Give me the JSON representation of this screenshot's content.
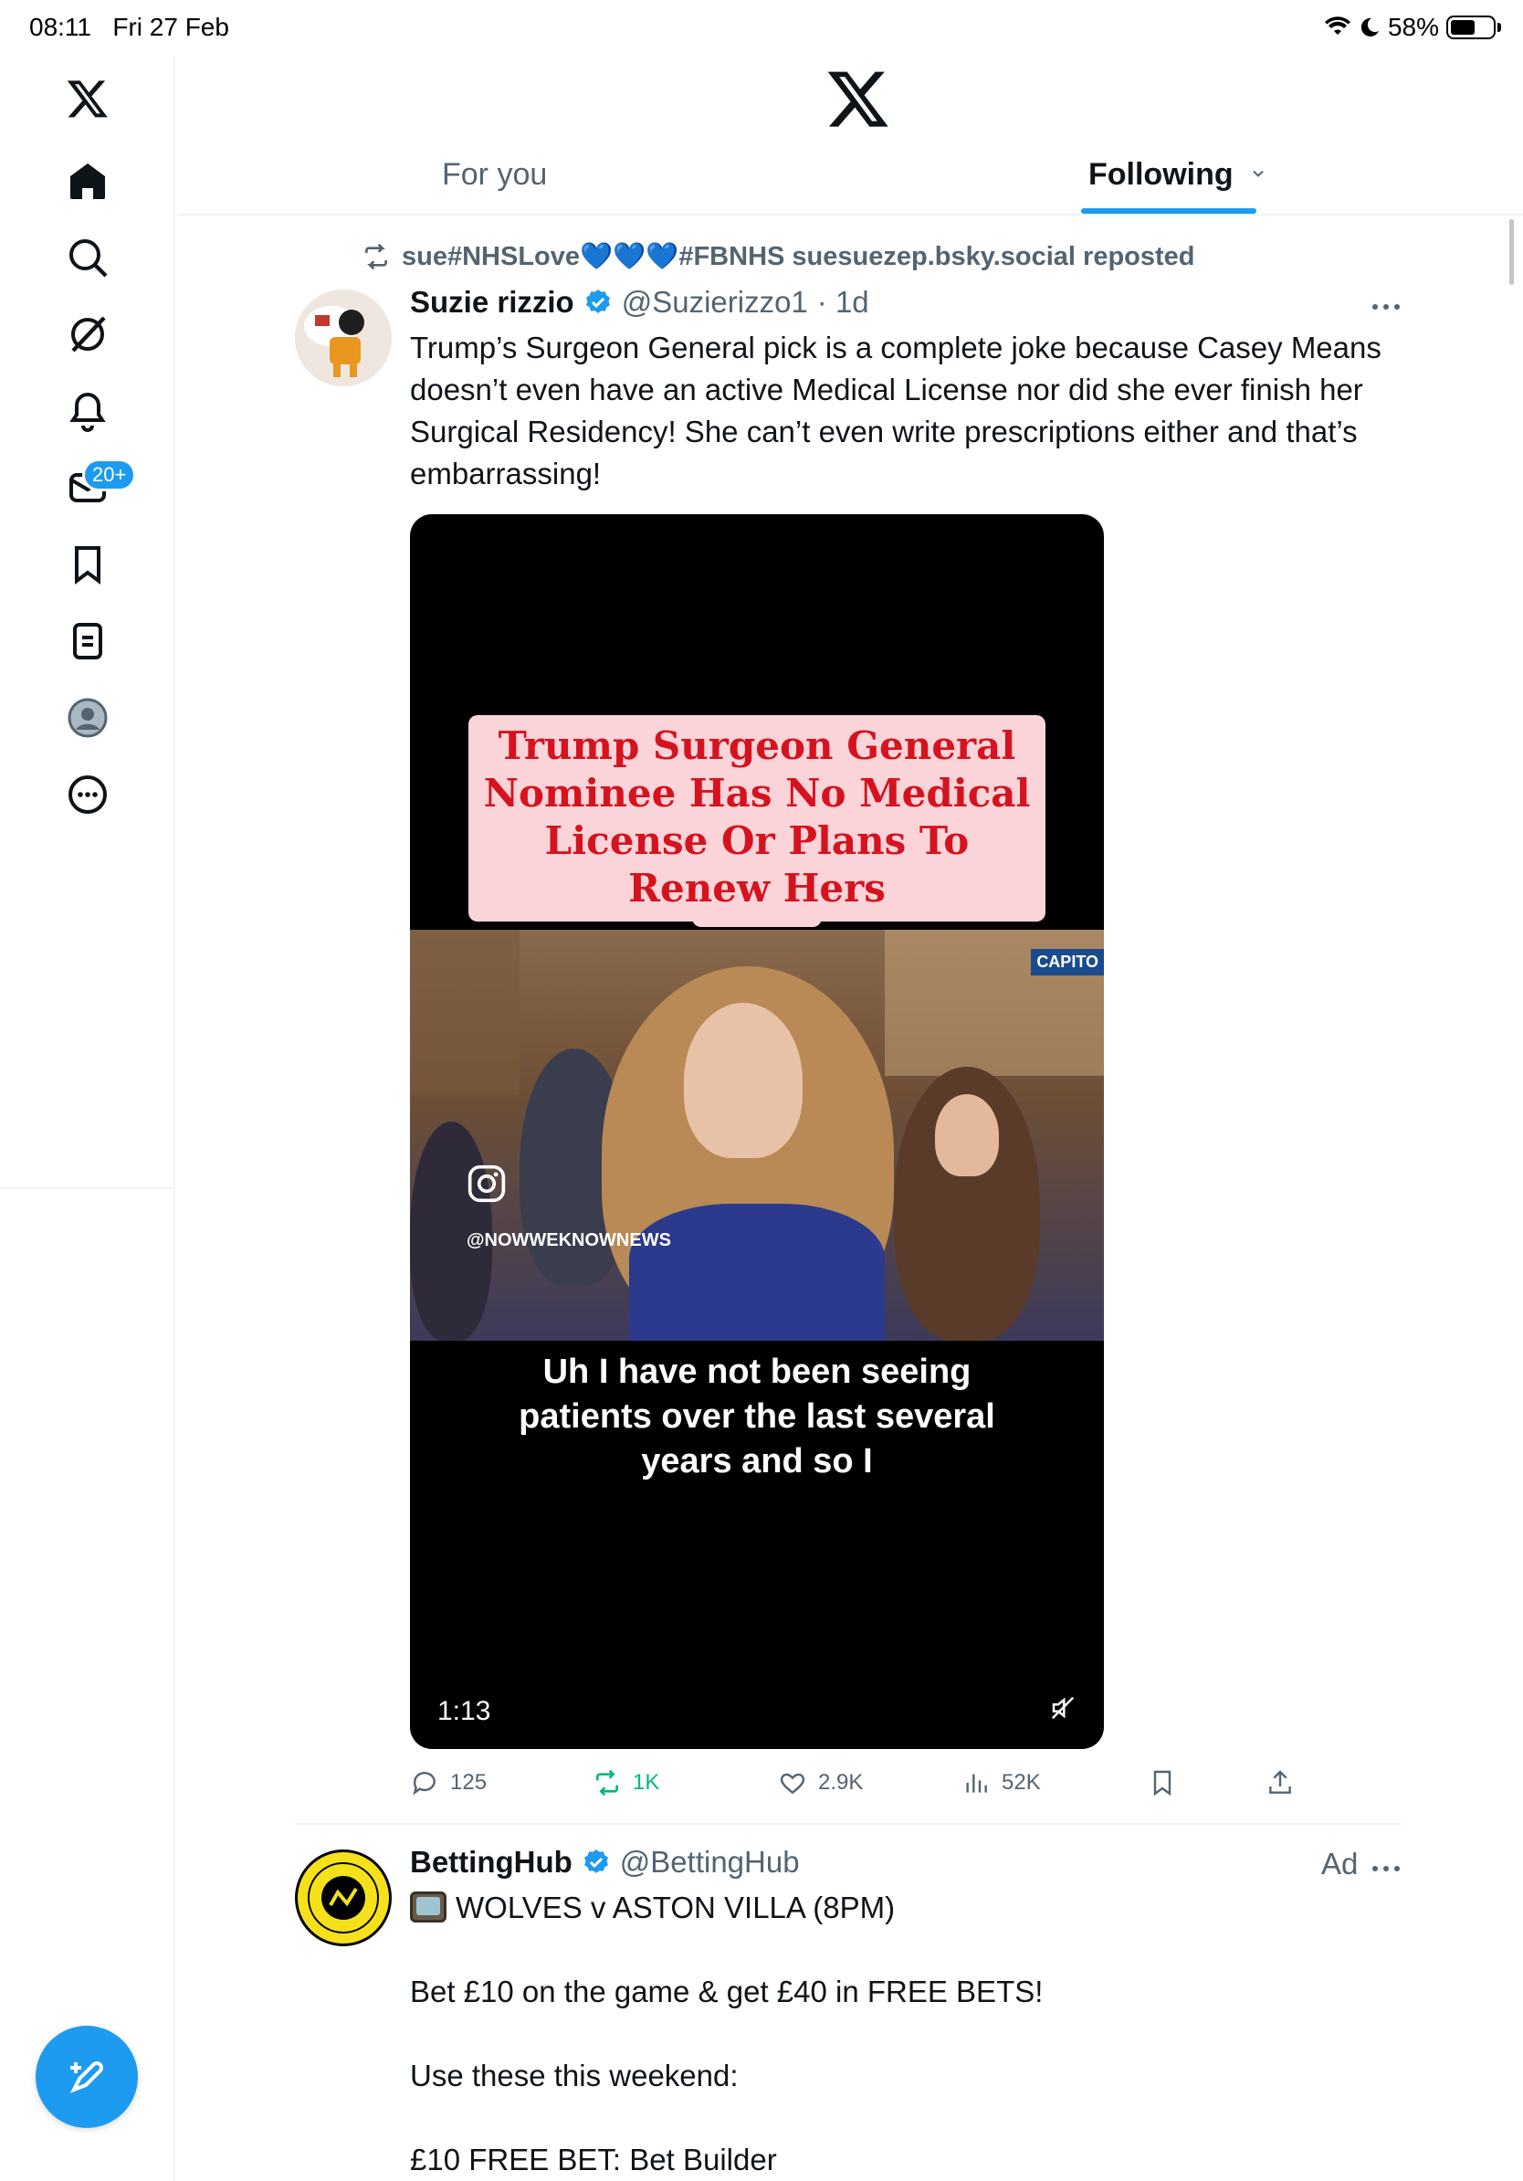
{
  "status_bar": {
    "time": "08:11",
    "date": "Fri 27 Feb",
    "battery_percent": "58%",
    "battery_level": 0.58
  },
  "sidebar": {
    "notifications_badge": "20+",
    "items": [
      {
        "name": "home"
      },
      {
        "name": "explore"
      },
      {
        "name": "grok"
      },
      {
        "name": "notifications"
      },
      {
        "name": "messages"
      },
      {
        "name": "bookmarks"
      },
      {
        "name": "lists"
      },
      {
        "name": "profile"
      },
      {
        "name": "more"
      }
    ]
  },
  "header": {
    "tabs": [
      {
        "label": "For you",
        "active": false
      },
      {
        "label": "Following",
        "active": true
      }
    ]
  },
  "tweet": {
    "repost_text": "sue#NHSLove💙💙💙#FBNHS suesuezep.bsky.social reposted",
    "author_name": "Suzie rizzio",
    "author_handle": "@Suzierizzo1",
    "time": "· 1d",
    "text": "Trump’s Surgeon General pick is a complete joke because Casey Means doesn’t even have an active Medical License nor did she ever finish her Surgical Residency! She can’t even write prescriptions either and that’s embarrassing!",
    "video": {
      "title_card": "Trump Surgeon General Nominee Has No Medical License Or Plans To Renew Hers",
      "network_tag": "CAPITO",
      "watermark": "@NOWWEKNOWNEWS",
      "caption": "Uh I have not been seeing patients over the last several years and so I",
      "duration": "1:13"
    },
    "stats": {
      "replies": "125",
      "reposts": "1K",
      "likes": "2.9K",
      "views": "52K"
    }
  },
  "ad": {
    "author_name": "BettingHub",
    "author_handle": "@BettingHub",
    "label": "Ad",
    "lines": [
      "WOLVES v ASTON VILLA (8PM)",
      "",
      "Bet £10 on the game & get £40 in FREE BETS!",
      "",
      "Use these this weekend:",
      "",
      "£10 FREE BET: Bet Builder"
    ]
  },
  "colors": {
    "accent": "#1d9bf0",
    "text_primary": "#0f1419",
    "text_secondary": "#536471",
    "repost_green": "#00ba7c",
    "card_red": "#d5131f",
    "card_pink": "#fad4d8"
  }
}
